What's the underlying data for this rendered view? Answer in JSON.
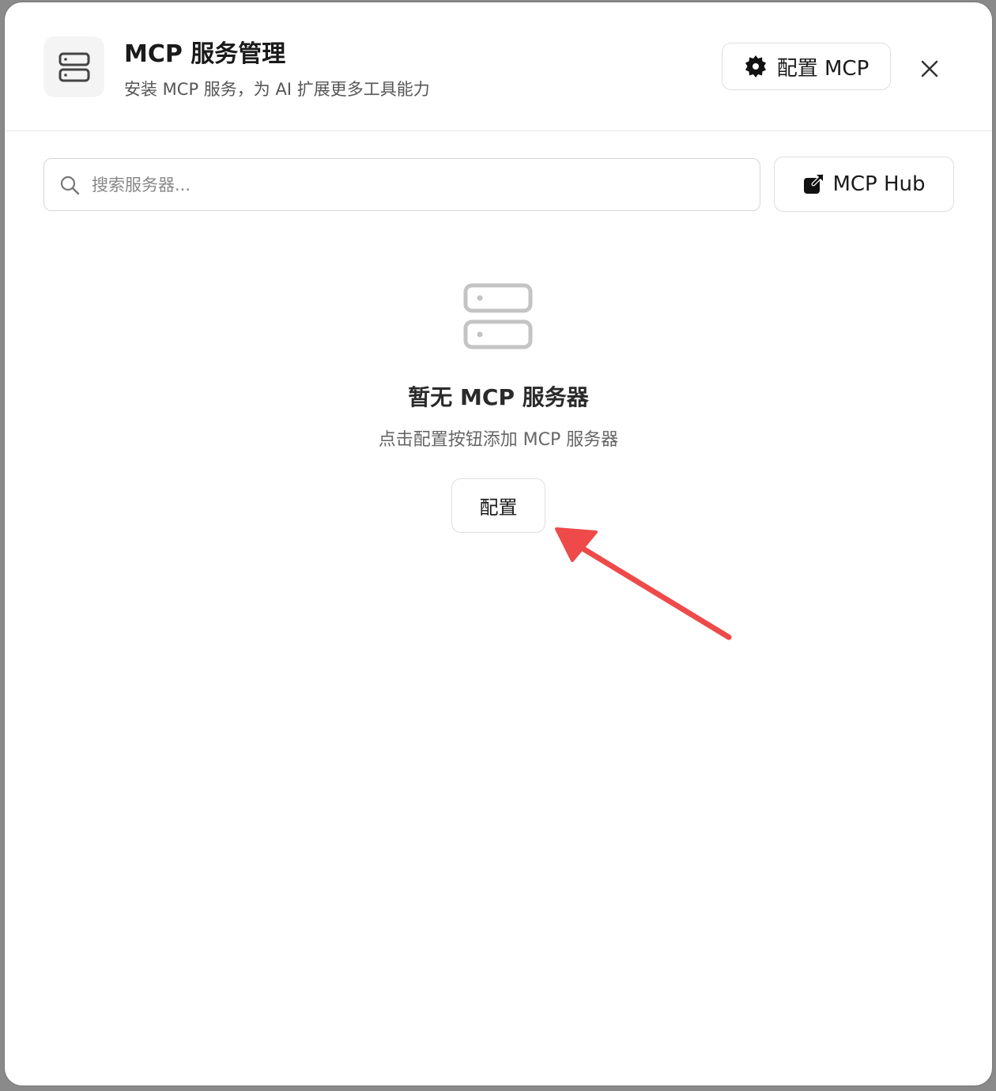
{
  "header": {
    "title": "MCP 服务管理",
    "subtitle": "安装 MCP 服务，为 AI 扩展更多工具能力",
    "configure_mcp_label": "配置 MCP",
    "icons": {
      "app": "server-icon",
      "configure": "gear-icon",
      "close": "close-icon"
    }
  },
  "toolbar": {
    "search_placeholder": "搜索服务器...",
    "search_value": "",
    "hub_label": "MCP Hub",
    "icons": {
      "search": "search-icon",
      "hub": "external-link-icon"
    }
  },
  "empty_state": {
    "icon": "server-icon",
    "title": "暂无 MCP 服务器",
    "description": "点击配置按钮添加 MCP 服务器",
    "button_label": "配置"
  },
  "annotation": {
    "arrow_color": "#ee4a4a",
    "target": "配置"
  }
}
